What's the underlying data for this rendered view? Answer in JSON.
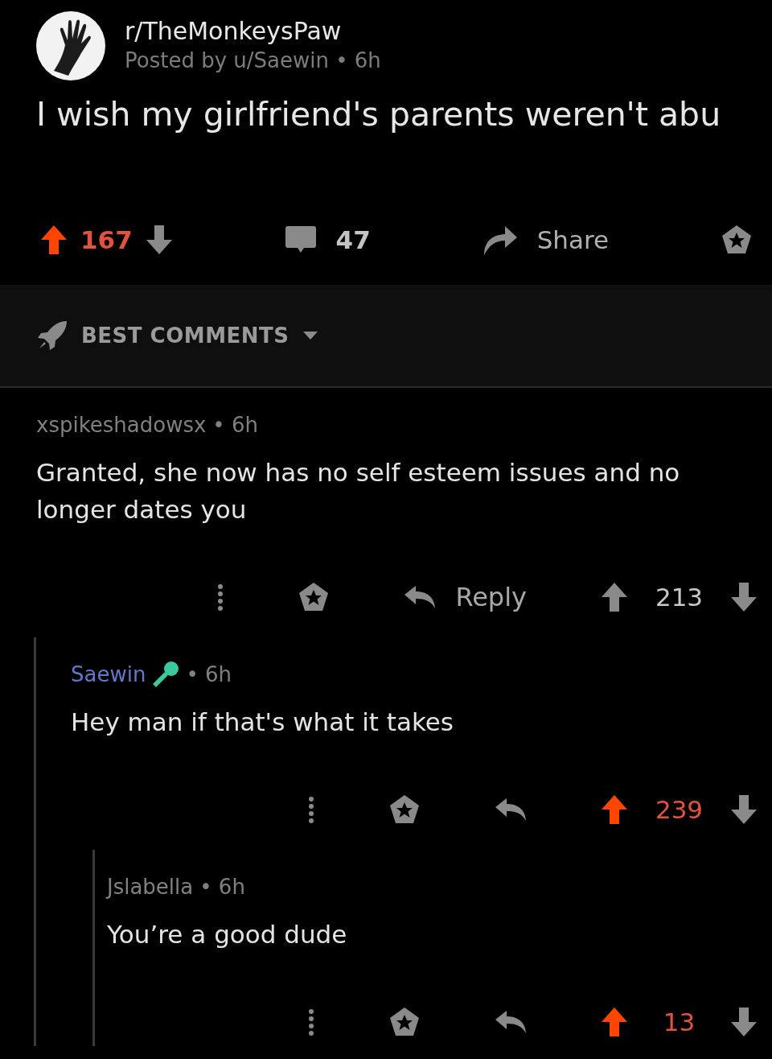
{
  "post": {
    "subreddit": "r/TheMonkeysPaw",
    "byline": "Posted by u/Saewin • 6h",
    "title": "I wish my girlfriend's parents weren't abu",
    "upvoted": true,
    "score": "167",
    "comment_count": "47",
    "share_label": "Share"
  },
  "sort": {
    "label": "BEST COMMENTS"
  },
  "comments": [
    {
      "author": "xspikeshadowsx",
      "is_op": false,
      "flair": false,
      "time": "• 6h",
      "body": "Granted, she now has no self esteem issues and no longer dates you",
      "reply_label": "Reply",
      "upvoted": false,
      "score": "213",
      "children": [
        {
          "author": "Saewin",
          "is_op": true,
          "flair": true,
          "time": "• 6h",
          "body": "Hey man if that's what it takes",
          "upvoted": true,
          "score": "239",
          "children": [
            {
              "author": "Jslabella",
              "is_op": false,
              "flair": false,
              "time": "• 6h",
              "body": "You’re a good dude",
              "upvoted": true,
              "score": "13"
            }
          ]
        }
      ]
    }
  ]
}
